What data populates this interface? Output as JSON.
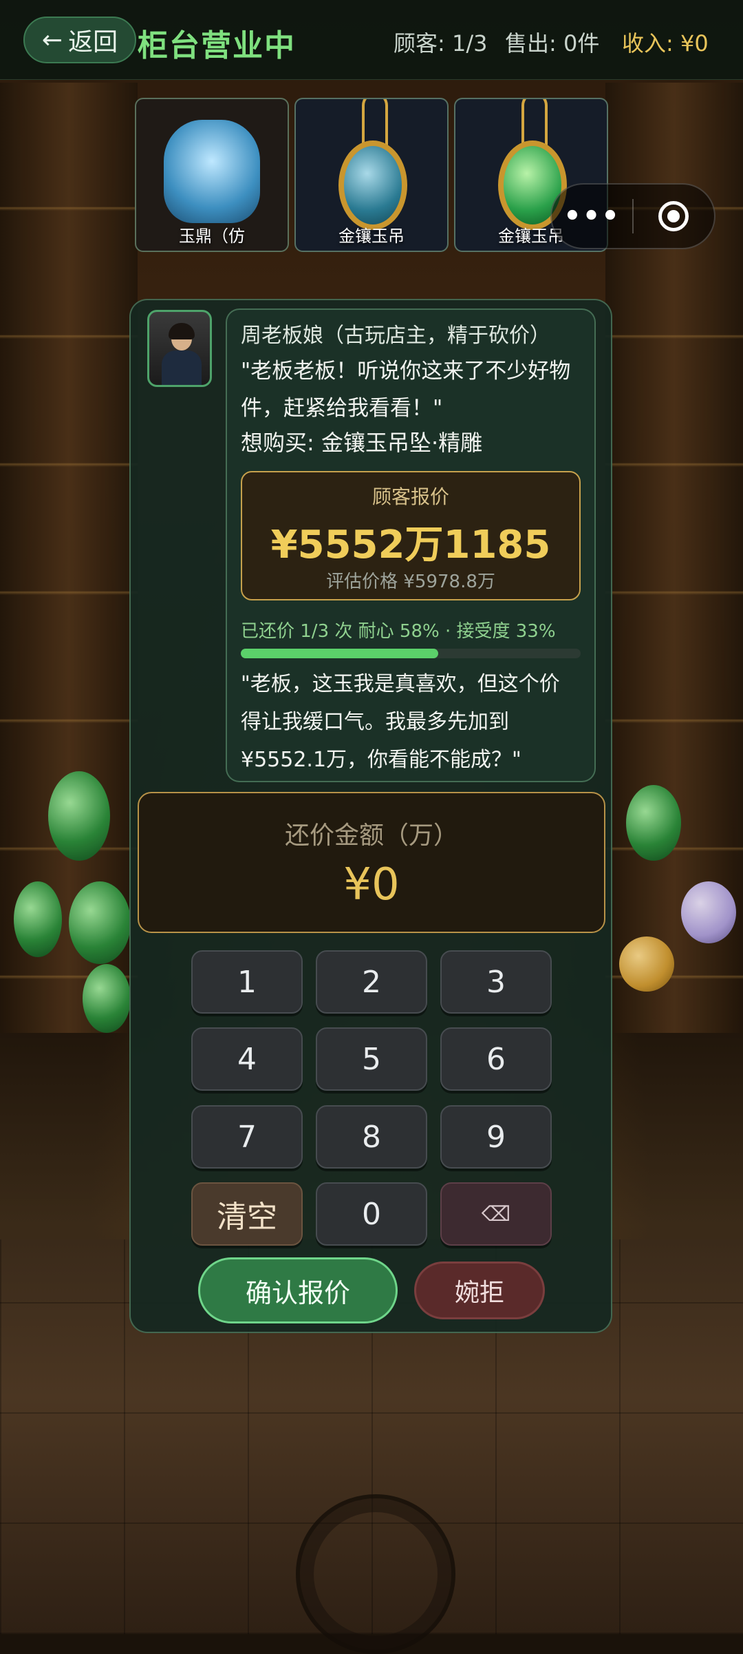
{
  "header": {
    "back_label": "返回",
    "title": "柜台营业中",
    "customers": "顾客: 1/3",
    "sold": "售出: 0件",
    "income": "收入: ¥0"
  },
  "goods": [
    {
      "label": "玉鼎（仿"
    },
    {
      "label": "金镶玉吊"
    },
    {
      "label": "金镶玉吊"
    }
  ],
  "capsule": {
    "more": "•••"
  },
  "customer": {
    "name": "周老板娘（古玩店主，精于砍价）",
    "line": "\"老板老板！听说你这来了不少好物件，赶紧给我看看！\"",
    "want": "想购买: 金镶玉吊坠·精雕"
  },
  "offer": {
    "label": "顾客报价",
    "price": "¥5552万1185",
    "estimate": "评估价格 ¥5978.8万"
  },
  "status": {
    "text": "已还价 1/3 次  耐心 58% · 接受度 33%",
    "patience_fraction": 0.58
  },
  "reply": {
    "line": "\"老板，这玉我是真喜欢，但这个价得让我缓口气。我最多先加到¥5552.1万，你看能不能成？\""
  },
  "counter": {
    "label": "还价金额（万）",
    "value": "¥0"
  },
  "keypad": {
    "k1": "1",
    "k2": "2",
    "k3": "3",
    "k4": "4",
    "k5": "5",
    "k6": "6",
    "k7": "7",
    "k8": "8",
    "k9": "9",
    "clear": "清空",
    "k0": "0",
    "del": "⌫"
  },
  "actions": {
    "confirm": "确认报价",
    "reject": "婉拒"
  },
  "colors": {
    "accent_green": "#7fe07f",
    "gold": "#e8c45a",
    "panel": "#16281f"
  }
}
